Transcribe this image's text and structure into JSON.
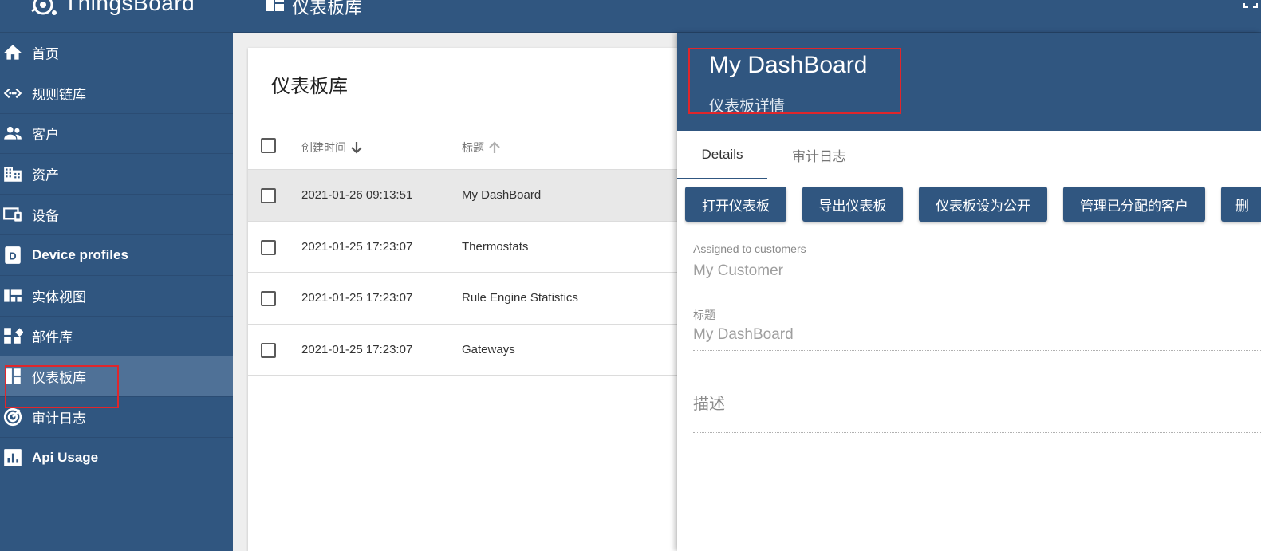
{
  "app": {
    "name": "ThingsBoard"
  },
  "topbar": {
    "title": "仪表板库"
  },
  "sidebar": {
    "items": [
      {
        "label": "首页",
        "icon": "home-icon",
        "bold": false,
        "active": false
      },
      {
        "label": "规则链库",
        "icon": "code-arrows-icon",
        "bold": false,
        "active": false
      },
      {
        "label": "客户",
        "icon": "people-icon",
        "bold": false,
        "active": false
      },
      {
        "label": "资产",
        "icon": "building-icon",
        "bold": false,
        "active": false
      },
      {
        "label": "设备",
        "icon": "devices-icon",
        "bold": false,
        "active": false
      },
      {
        "label": "Device profiles",
        "icon": "device-profile-icon",
        "bold": true,
        "active": false
      },
      {
        "label": "实体视图",
        "icon": "view-quilt-icon",
        "bold": false,
        "active": false
      },
      {
        "label": "部件库",
        "icon": "widgets-icon",
        "bold": false,
        "active": false
      },
      {
        "label": "仪表板库",
        "icon": "dashboard-icon",
        "bold": false,
        "active": true
      },
      {
        "label": "审计日志",
        "icon": "track-changes-icon",
        "bold": false,
        "active": false
      },
      {
        "label": "Api Usage",
        "icon": "chart-bar-icon",
        "bold": true,
        "active": false
      }
    ]
  },
  "main": {
    "title": "仪表板库",
    "columns": {
      "created": "创建时间",
      "title": "标题"
    },
    "rows": [
      {
        "created": "2021-01-26 09:13:51",
        "title": "My DashBoard",
        "selected": true
      },
      {
        "created": "2021-01-25 17:23:07",
        "title": "Thermostats",
        "selected": false
      },
      {
        "created": "2021-01-25 17:23:07",
        "title": "Rule Engine Statistics",
        "selected": false
      },
      {
        "created": "2021-01-25 17:23:07",
        "title": "Gateways",
        "selected": false
      }
    ]
  },
  "details": {
    "title": "My DashBoard",
    "subtitle": "仪表板详情",
    "tabs": [
      "Details",
      "审计日志"
    ],
    "buttons": [
      "打开仪表板",
      "导出仪表板",
      "仪表板设为公开",
      "管理已分配的客户",
      "删"
    ],
    "assigned_label": "Assigned to customers",
    "assigned_value": "My Customer",
    "title_label": "标题",
    "title_value": "My DashBoard",
    "description_placeholder": "描述"
  },
  "colors": {
    "primary": "#305680",
    "sidebar_active": "#4f7197",
    "highlight": "#e0262b"
  }
}
